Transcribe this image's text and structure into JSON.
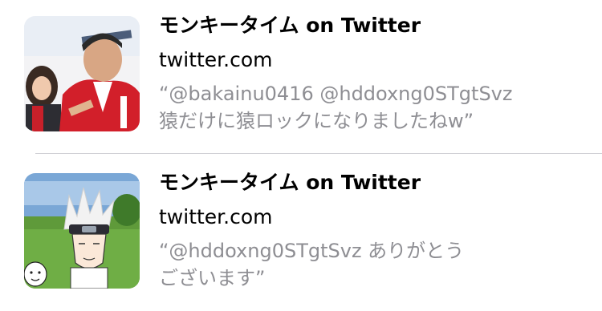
{
  "results": [
    {
      "title": "モンキータイム on Twitter",
      "domain": "twitter.com",
      "quote_line_1": "“@bakainu0416 @hddoxng0STgtSvz",
      "quote_line_2": "猿だけに猿ロックになりましたねw”",
      "thumbnail_icon": "photo-two-people-icon"
    },
    {
      "title": "モンキータイム on Twitter",
      "domain": "twitter.com",
      "quote_line_1": "“@hddoxng0STgtSvz ありがとう",
      "quote_line_2": "ございます”",
      "thumbnail_icon": "cartoon-avatar-icon"
    }
  ],
  "colors": {
    "title": "#000000",
    "secondary_text": "#8e8e93",
    "separator": "#d1d1d6"
  }
}
